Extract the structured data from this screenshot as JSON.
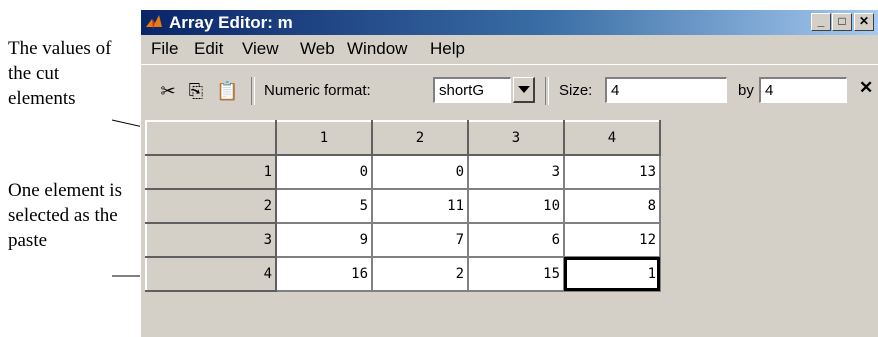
{
  "annotations": {
    "cut_values": "The values of the cut elements",
    "paste_target": "One element is selected as the paste"
  },
  "window": {
    "title": "Array Editor: m",
    "controls": [
      "minimize",
      "maximize",
      "close"
    ]
  },
  "menu": {
    "items": [
      "File",
      "Edit",
      "View",
      "Web",
      "Window",
      "Help"
    ]
  },
  "toolbar": {
    "icons": [
      "cut-icon",
      "copy-icon",
      "paste-icon"
    ],
    "numeric_format_label": "Numeric format:",
    "numeric_format_value": "shortG",
    "size_label": "Size:",
    "rows_value": "4",
    "by_label": "by",
    "cols_value": "4"
  },
  "grid": {
    "columns": [
      "1",
      "2",
      "3",
      "4"
    ],
    "rows": [
      {
        "label": "1",
        "values": [
          "0",
          "0",
          "3",
          "13"
        ]
      },
      {
        "label": "2",
        "values": [
          "5",
          "11",
          "10",
          "8"
        ]
      },
      {
        "label": "3",
        "values": [
          "9",
          "7",
          "6",
          "12"
        ]
      },
      {
        "label": "4",
        "values": [
          "16",
          "2",
          "15",
          "1"
        ]
      }
    ],
    "selected": {
      "row": 4,
      "col": 4
    }
  }
}
